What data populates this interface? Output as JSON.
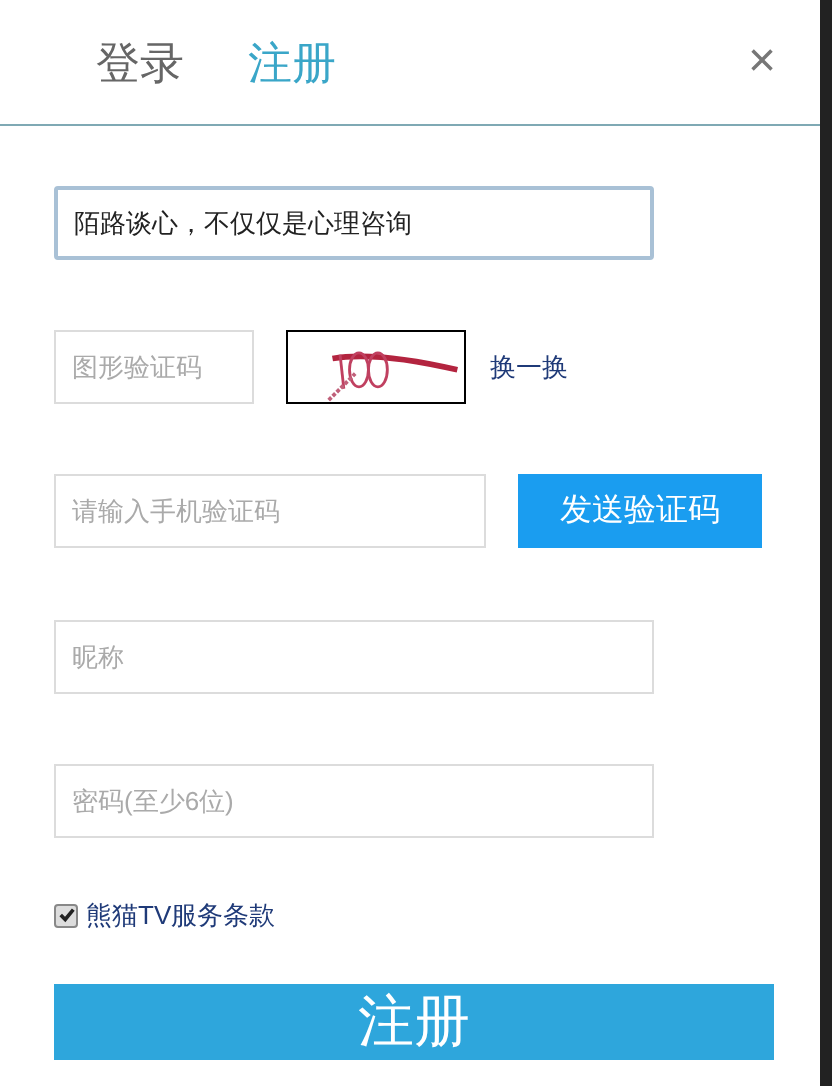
{
  "tabs": [
    {
      "label": "登录",
      "selected": false
    },
    {
      "label": "注册",
      "selected": true
    }
  ],
  "close": "×",
  "motto_field": {
    "value": "陌路谈心，不仅仅是心理咨询"
  },
  "captcha": {
    "placeholder": "图形验证码",
    "refresh": "换一换"
  },
  "phone_code": {
    "placeholder": "请输入手机验证码",
    "send_button": "发送验证码"
  },
  "nickname": {
    "placeholder": "昵称"
  },
  "password": {
    "placeholder": "密码(至少6位)"
  },
  "terms": {
    "label": "熊猫TV服务条款",
    "checked": true
  },
  "submit": "注册"
}
